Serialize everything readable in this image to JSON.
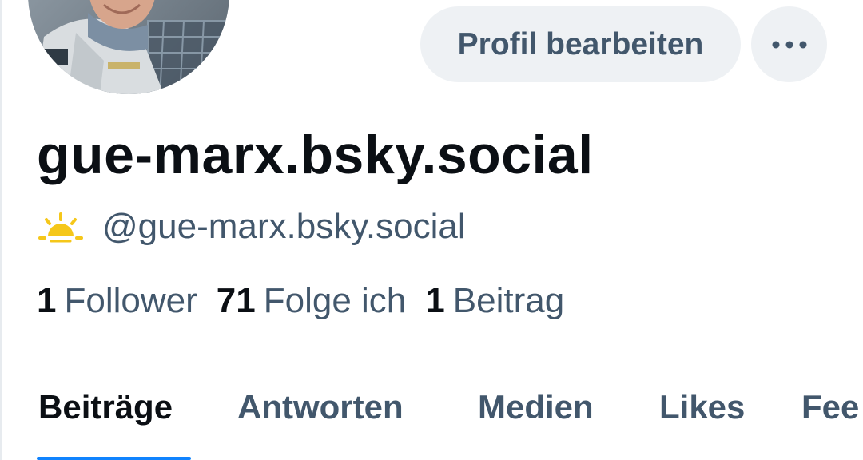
{
  "profile": {
    "display_name": "gue-marx.bsky.social",
    "handle": "@gue-marx.bsky.social",
    "badge_icon": "sunrise-icon",
    "avatar_icon": "profile-photo"
  },
  "actions": {
    "edit_label": "Profil bearbeiten",
    "more_icon": "ellipsis-icon"
  },
  "stats": [
    {
      "count": "1",
      "label": "Follower"
    },
    {
      "count": "71",
      "label": "Folge ich"
    },
    {
      "count": "1",
      "label": "Beitrag"
    }
  ],
  "tabs": [
    {
      "label": "Beiträge",
      "active": true
    },
    {
      "label": "Antworten",
      "active": false
    },
    {
      "label": "Medien",
      "active": false
    },
    {
      "label": "Likes",
      "active": false
    },
    {
      "label": "Fee",
      "active": false
    }
  ],
  "colors": {
    "accent": "#1083fe",
    "muted_text": "#42576c",
    "button_bg": "#eef1f4",
    "badge": "#f5c71a"
  }
}
